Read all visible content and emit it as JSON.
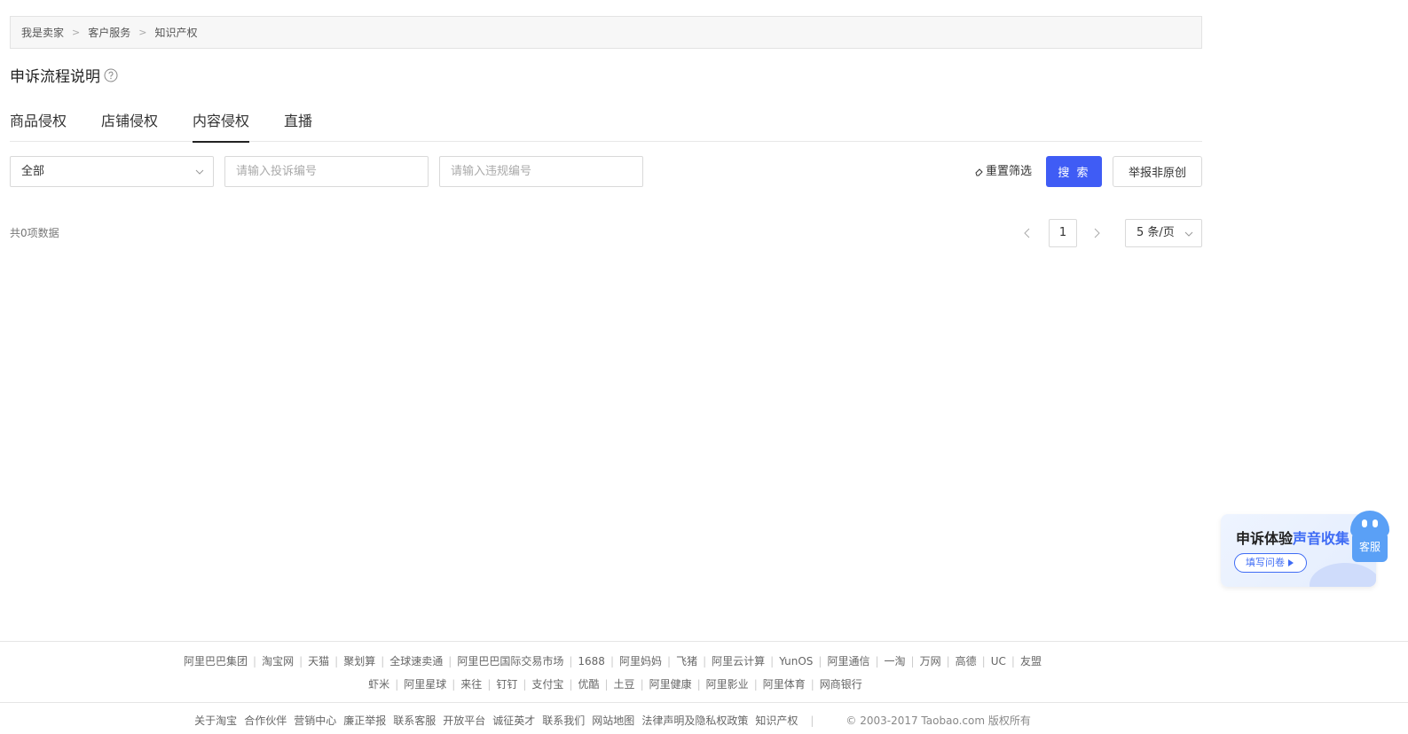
{
  "breadcrumb": [
    "我是卖家",
    "客户服务",
    "知识产权"
  ],
  "page_title": "申诉流程说明",
  "tabs": [
    {
      "label": "商品侵权",
      "active": false
    },
    {
      "label": "店铺侵权",
      "active": false
    },
    {
      "label": "内容侵权",
      "active": true
    },
    {
      "label": "直播",
      "active": false
    }
  ],
  "filters": {
    "type_select": "全部",
    "complaint_placeholder": "请输入投诉编号",
    "violation_placeholder": "请输入违规编号",
    "reset_label": "重置筛选",
    "search_label": "搜 索",
    "report_label": "举报非原创"
  },
  "list": {
    "total_text": "共0项数据"
  },
  "pagination": {
    "current_page": "1",
    "page_size": "5 条/页"
  },
  "feedback": {
    "title_prefix": "申诉体验",
    "title_highlight": "声音收集",
    "button_label": "填写问卷"
  },
  "service": {
    "label": "客服"
  },
  "footer": {
    "row1": [
      "阿里巴巴集团",
      "淘宝网",
      "天猫",
      "聚划算",
      "全球速卖通",
      "阿里巴巴国际交易市场",
      "1688",
      "阿里妈妈",
      "飞猪",
      "阿里云计算",
      "YunOS",
      "阿里通信",
      "一淘",
      "万网",
      "高德",
      "UC",
      "友盟"
    ],
    "row2": [
      "虾米",
      "阿里星球",
      "来往",
      "钉钉",
      "支付宝",
      "优酷",
      "土豆",
      "阿里健康",
      "阿里影业",
      "阿里体育",
      "网商银行"
    ],
    "row3": [
      "关于淘宝",
      "合作伙伴",
      "营销中心",
      "廉正举报",
      "联系客服",
      "开放平台",
      "诚征英才",
      "联系我们",
      "网站地图",
      "法律声明及隐私权政策",
      "知识产权"
    ],
    "copyright": "© 2003-2017 Taobao.com 版权所有"
  },
  "colors": {
    "primary": "#3f5cf5",
    "accent": "#3f6cf5",
    "service": "#5aa0f6"
  }
}
